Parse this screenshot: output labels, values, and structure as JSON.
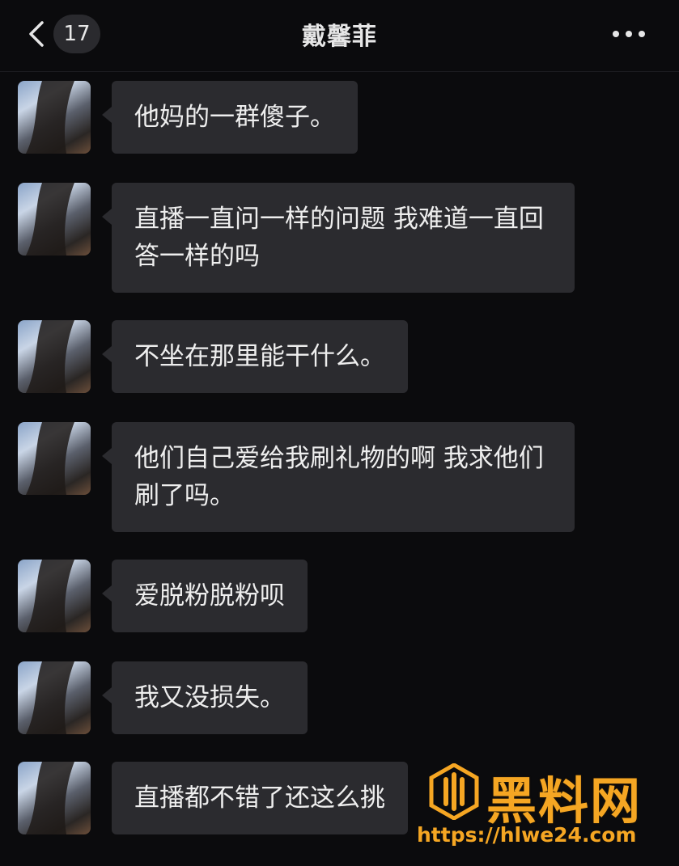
{
  "header": {
    "unread_count": "17",
    "contact_name": "戴馨菲"
  },
  "messages": [
    {
      "text": "他妈的一群傻子。"
    },
    {
      "text": "直播一直问一样的问题 我难道一直回答一样的吗"
    },
    {
      "text": "不坐在那里能干什么。"
    },
    {
      "text": "他们自己爱给我刷礼物的啊 我求他们刷了吗。"
    },
    {
      "text": "爱脱粉脱粉呗"
    },
    {
      "text": "我又没损失。"
    },
    {
      "text": "直播都不错了还这么挑"
    }
  ],
  "watermark": {
    "title": "黑料网",
    "url": "https://hlwe24.com"
  },
  "colors": {
    "background": "#0b0b0d",
    "bubble": "#2b2b2f",
    "watermark": "#f5a623"
  },
  "icons": {
    "back": "chevron-left-icon",
    "more": "more-dots-icon",
    "watermark_logo": "brand-logo-icon"
  }
}
